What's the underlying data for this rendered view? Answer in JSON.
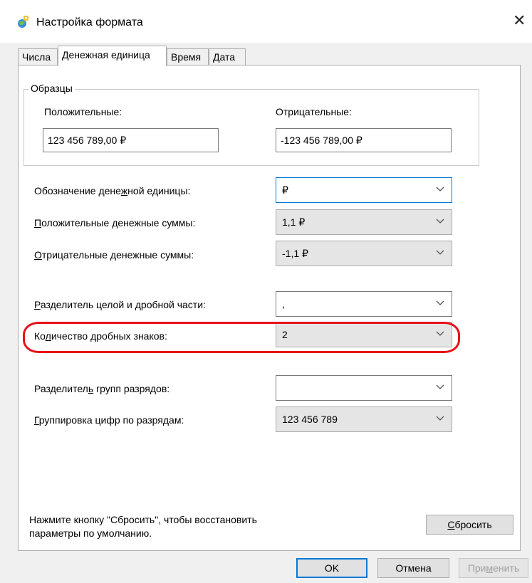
{
  "window": {
    "title": "Настройка формата"
  },
  "tabs": [
    {
      "label": "Числа"
    },
    {
      "label": "Денежная единица"
    },
    {
      "label": "Время"
    },
    {
      "label": "Дата"
    }
  ],
  "samples": {
    "title": "Образцы",
    "positive_label": "Положительные:",
    "positive_value": "123 456 789,00 ₽",
    "negative_label": "Отрицательные:",
    "negative_value": "-123 456 789,00 ₽"
  },
  "settings": {
    "symbol": {
      "label_pre": "Обозначение дене",
      "label_u": "ж",
      "label_post": "ной единицы:",
      "value": "₽"
    },
    "positive_format": {
      "label_pre": "",
      "label_u": "П",
      "label_post": "оложительные денежные суммы:",
      "value": "1,1 ₽"
    },
    "negative_format": {
      "label_pre": "",
      "label_u": "О",
      "label_post": "трицательные денежные суммы:",
      "value": "-1,1 ₽"
    },
    "decimal_separator": {
      "label_pre": "",
      "label_u": "Р",
      "label_post": "азделитель целой и дробной части:",
      "value": ","
    },
    "decimal_digits": {
      "label_pre": "Ко",
      "label_u": "л",
      "label_post": "ичество дробных знаков:",
      "value": "2"
    },
    "group_separator": {
      "label_pre": "Разделител",
      "label_u": "ь",
      "label_post": " групп разрядов:",
      "value": ""
    },
    "grouping": {
      "label_pre": "",
      "label_u": "Г",
      "label_post": "руппировка цифр по разрядам:",
      "value": "123 456 789"
    }
  },
  "footer": {
    "reset_hint_line1": "Нажмите кнопку \"Сбросить\", чтобы восстановить",
    "reset_hint_line2": "параметры по умолчанию.",
    "reset_button_u": "С",
    "reset_button_rest": "бросить"
  },
  "buttons": {
    "ok": "OK",
    "cancel": "Отмена",
    "apply_pre": "При",
    "apply_u": "м",
    "apply_post": "енить"
  },
  "colors": {
    "highlight": "#e8111a",
    "focus": "#0078d7"
  }
}
